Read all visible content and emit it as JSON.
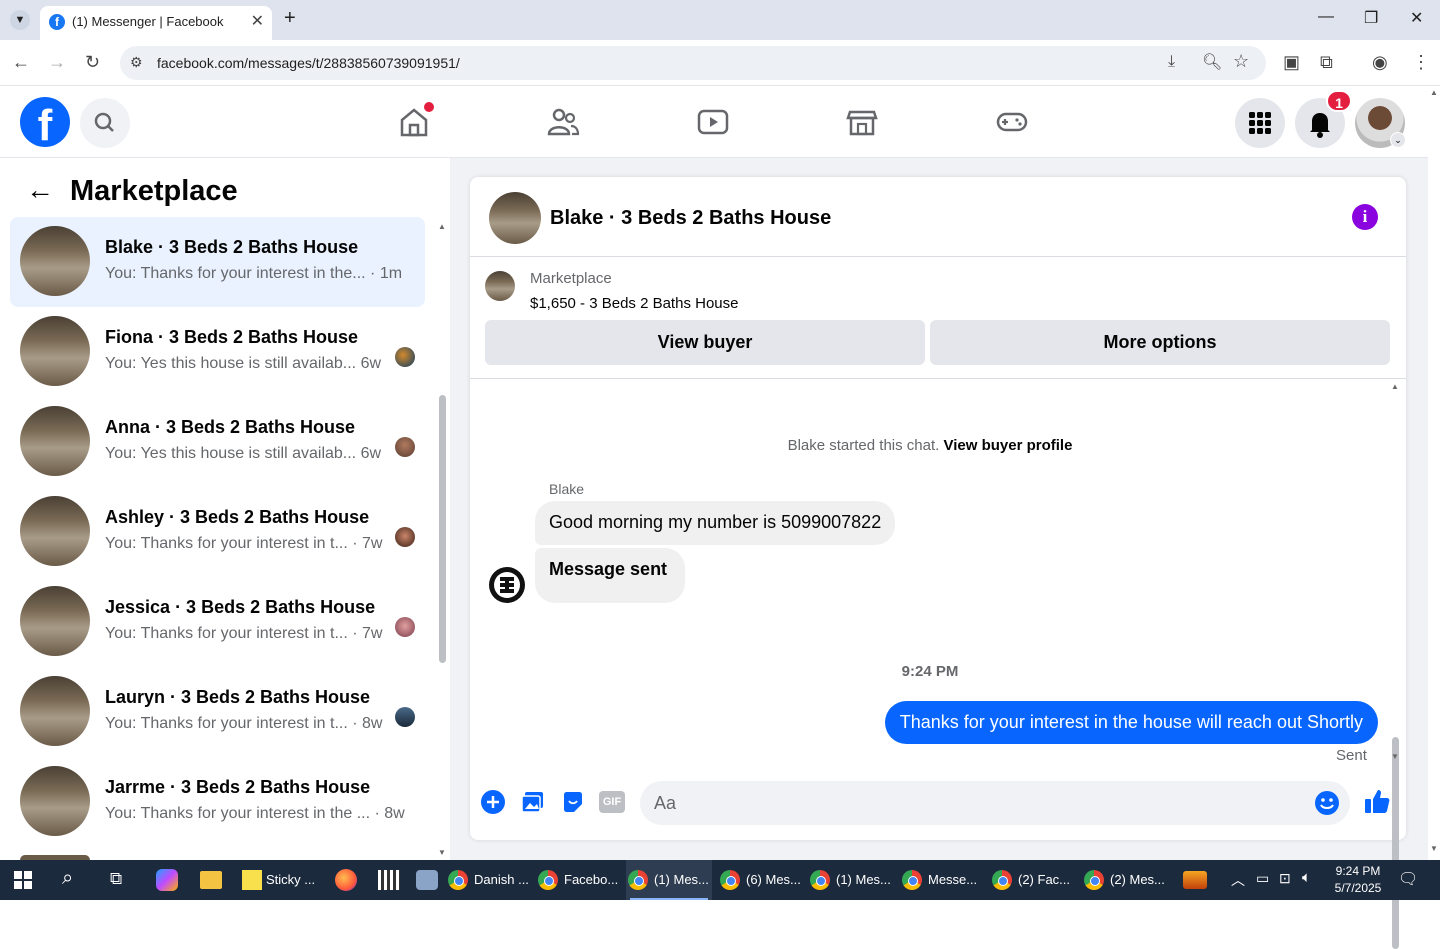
{
  "browser": {
    "tab_title": "(1) Messenger | Facebook",
    "url": "facebook.com/messages/t/28838560739091951/"
  },
  "header": {
    "notifications_count": "1"
  },
  "left_panel": {
    "title": "Marketplace",
    "conversations": [
      {
        "name": "Blake · 3 Beds 2 Baths House",
        "snippet": "You: Thanks for your interest in the...",
        "time": "· 1m",
        "active": true
      },
      {
        "name": "Fiona · 3 Beds 2 Baths House",
        "snippet": "You: Yes this house is still availab...",
        "time": "6w"
      },
      {
        "name": "Anna · 3 Beds 2 Baths House",
        "snippet": "You: Yes this house is still availab...",
        "time": "6w"
      },
      {
        "name": "Ashley · 3 Beds 2 Baths House",
        "snippet": "You: Thanks for your interest in t...",
        "time": "· 7w"
      },
      {
        "name": "Jessica · 3 Beds 2 Baths House",
        "snippet": "You: Thanks for your interest in t...",
        "time": "· 7w"
      },
      {
        "name": "Lauryn · 3 Beds 2 Baths House",
        "snippet": "You: Thanks for your interest in t...",
        "time": "· 8w"
      },
      {
        "name": "Jarrme · 3 Beds 2 Baths House",
        "snippet": "You: Thanks for your interest in the ...",
        "time": "· 8w"
      }
    ]
  },
  "chat": {
    "title": "Blake · 3 Beds 2 Baths House",
    "listing_label": "Marketplace",
    "listing_price": "$1,650 - 3 Beds 2 Baths House",
    "view_buyer": "View buyer",
    "more_options": "More options",
    "started_text": "Blake started this chat.",
    "view_profile": "View buyer profile",
    "sender_name": "Blake",
    "msg1": "Good morning my number is 5099007822",
    "msg2": "Message sent",
    "timestamp": "9:24 PM",
    "outgoing": "Thanks for your interest in the house will reach out Shortly",
    "status": "Sent",
    "input_placeholder": "Aa"
  },
  "taskbar": {
    "items": [
      "Sticky ...",
      "Danish ...",
      "Facebo...",
      "(1) Mes...",
      "(6) Mes...",
      "(1) Mes...",
      "Messe...",
      "(2) Fac...",
      "(2) Mes..."
    ],
    "time": "9:24 PM",
    "date": "5/7/2025"
  },
  "colors": {
    "accent": "#0866ff",
    "info": "#8a04df",
    "badge": "#e41e3f"
  }
}
